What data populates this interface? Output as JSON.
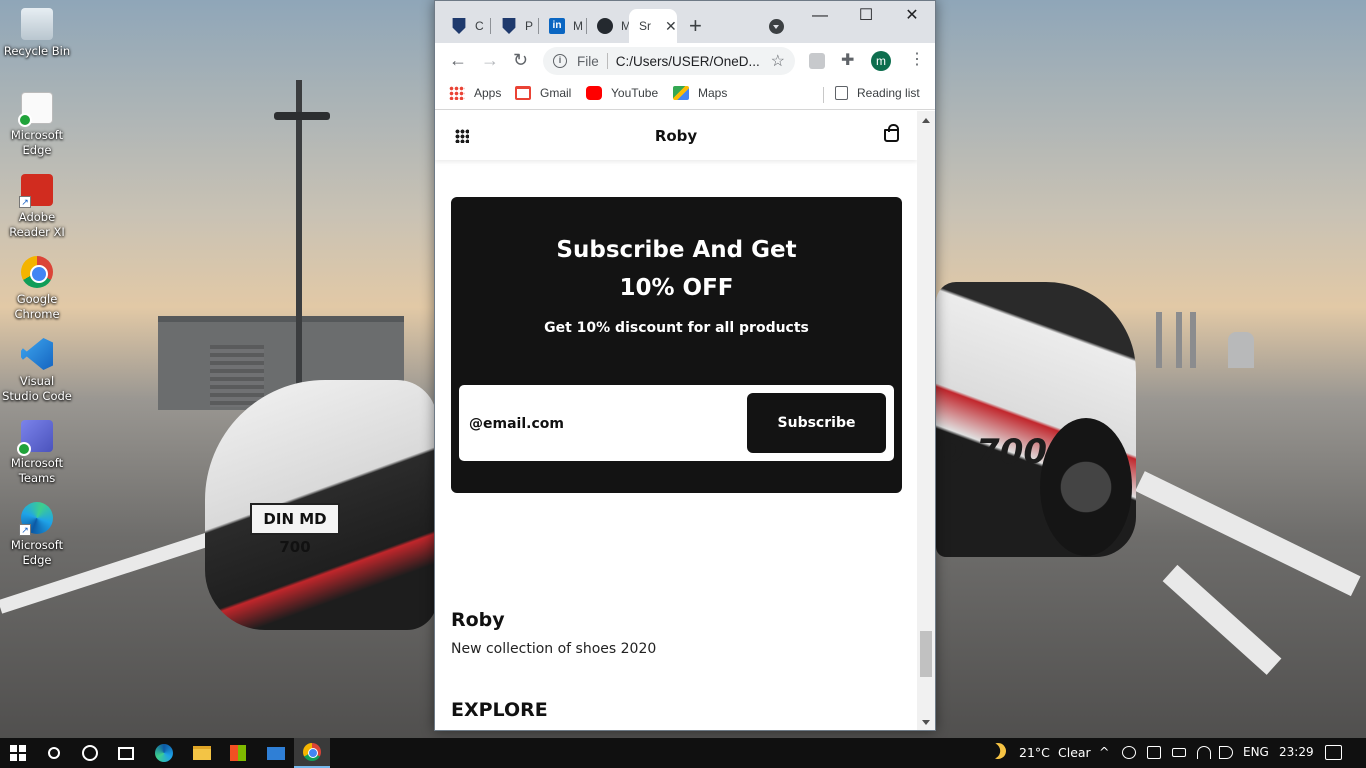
{
  "desktop": {
    "icons": [
      {
        "label": "Recycle Bin",
        "icon": "recycle-bin-icon"
      },
      {
        "label": "Microsoft Edge",
        "icon": "edge-document-icon"
      },
      {
        "label": "Adobe Reader XI",
        "icon": "adobe-reader-icon"
      },
      {
        "label": "Google Chrome",
        "icon": "chrome-icon"
      },
      {
        "label": "Visual Studio Code",
        "icon": "vscode-icon"
      },
      {
        "label": "Microsoft Teams",
        "icon": "teams-icon"
      },
      {
        "label": "Microsoft Edge",
        "icon": "edge-icon"
      }
    ],
    "wallpaper": {
      "plate_text": "DIN MD 700",
      "car_text": "D 700"
    }
  },
  "browser": {
    "tabs": [
      {
        "title": "C",
        "favicon": "shield-icon"
      },
      {
        "title": "P",
        "favicon": "shield-icon"
      },
      {
        "title": "M",
        "favicon": "linkedin-icon"
      },
      {
        "title": "M",
        "favicon": "github-icon"
      },
      {
        "title": "Sr",
        "favicon": "none",
        "active": true
      }
    ],
    "tab_close": "✕",
    "new_tab": "+",
    "window_controls": {
      "minimize": "—",
      "maximize": "☐",
      "close": "✕"
    },
    "toolbar": {
      "back": "←",
      "forward": "→",
      "reload": "↻",
      "info": "i",
      "scheme": "File",
      "url": "C:/Users/USER/OneD...",
      "star": "☆",
      "extensions": "✚",
      "profile_initial": "m",
      "menu": "⋮"
    },
    "bookmarks": [
      {
        "label": "Apps",
        "icon": "apps-icon"
      },
      {
        "label": "Gmail",
        "icon": "gmail-icon"
      },
      {
        "label": "YouTube",
        "icon": "youtube-icon"
      },
      {
        "label": "Maps",
        "icon": "maps-icon"
      }
    ],
    "reading_list": "Reading list"
  },
  "page": {
    "header": {
      "brand": "Roby"
    },
    "subscribe": {
      "title_line1": "Subscribe And Get",
      "title_line2": "10% OFF",
      "description": "Get 10% discount for all products",
      "email_placeholder": "@email.com",
      "button": "Subscribe"
    },
    "footer": {
      "brand": "Roby",
      "tagline": "New collection of shoes 2020",
      "explore_heading": "EXPLORE"
    },
    "colors": {
      "card_bg": "#131313",
      "button_bg": "#131313",
      "text_dark": "#111111"
    }
  },
  "taskbar": {
    "weather": {
      "temp": "21°C",
      "condition": "Clear"
    },
    "language": "ENG",
    "time": "23:29",
    "tray_chevron": "^"
  }
}
